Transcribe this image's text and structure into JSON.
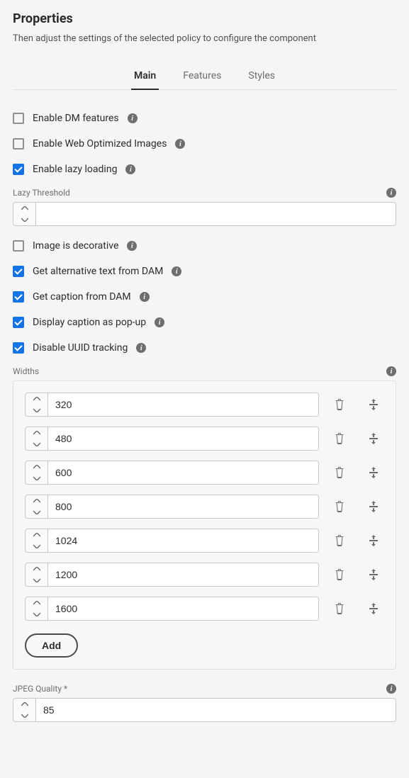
{
  "title": "Properties",
  "subtitle": "Then adjust the settings of the selected policy to configure the component",
  "tabs": {
    "main": "Main",
    "features": "Features",
    "styles": "Styles"
  },
  "checks": {
    "enable_dm": {
      "label": "Enable DM features",
      "checked": false
    },
    "enable_web_opt": {
      "label": "Enable Web Optimized Images",
      "checked": false
    },
    "enable_lazy": {
      "label": "Enable lazy loading",
      "checked": true
    },
    "decorative": {
      "label": "Image is decorative",
      "checked": false
    },
    "alt_from_dam": {
      "label": "Get alternative text from DAM",
      "checked": true
    },
    "caption_from_dam": {
      "label": "Get caption from DAM",
      "checked": true
    },
    "caption_popup": {
      "label": "Display caption as pop-up",
      "checked": true
    },
    "disable_uuid": {
      "label": "Disable UUID tracking",
      "checked": true
    }
  },
  "lazy_threshold": {
    "label": "Lazy Threshold",
    "value": ""
  },
  "widths": {
    "label": "Widths",
    "items": [
      "320",
      "480",
      "600",
      "800",
      "1024",
      "1200",
      "1600"
    ],
    "add_label": "Add"
  },
  "jpeg_quality": {
    "label": "JPEG Quality *",
    "value": "85"
  }
}
